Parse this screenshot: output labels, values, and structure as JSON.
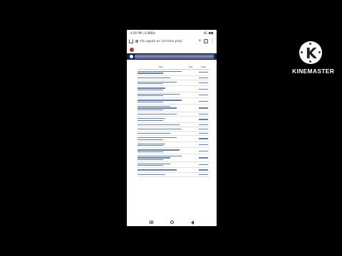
{
  "statusbar": {
    "time": "4:56 PM | 0.0KB/s",
    "signal": "4G",
    "battery": ""
  },
  "browser": {
    "url": "sfa.ugpah.ac.in/index.php/",
    "new_tab": "+",
    "tab_count": "1",
    "menu": "⋮"
  },
  "site": {
    "name": "",
    "nav": [
      "",
      "",
      "",
      "",
      ""
    ]
  },
  "content": {
    "section_title": "",
    "table_headers": [
      "Title",
      "Size",
      "Date"
    ]
  },
  "kinemaster": {
    "brand": "KINEMASTER",
    "icon_letter": "K"
  }
}
